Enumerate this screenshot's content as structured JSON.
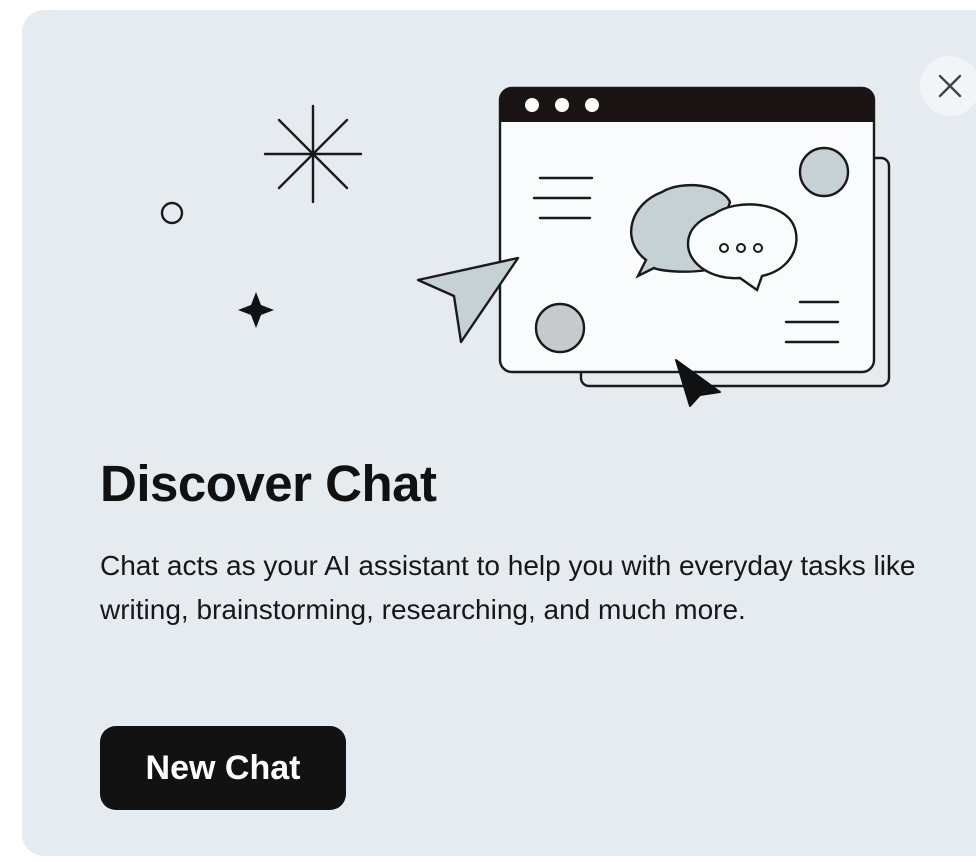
{
  "dialog": {
    "title": "Discover Chat",
    "description": "Chat acts as your AI assistant to help you with everyday tasks like writing, brainstorming, researching, and much more.",
    "primary_button_label": "New Chat",
    "close_icon": "close-icon"
  },
  "colors": {
    "card_background": "#e5ebef",
    "button_background": "#121212",
    "button_text": "#ffffff",
    "title_text": "#111111",
    "illustration_accent": "#c8d3d9"
  }
}
